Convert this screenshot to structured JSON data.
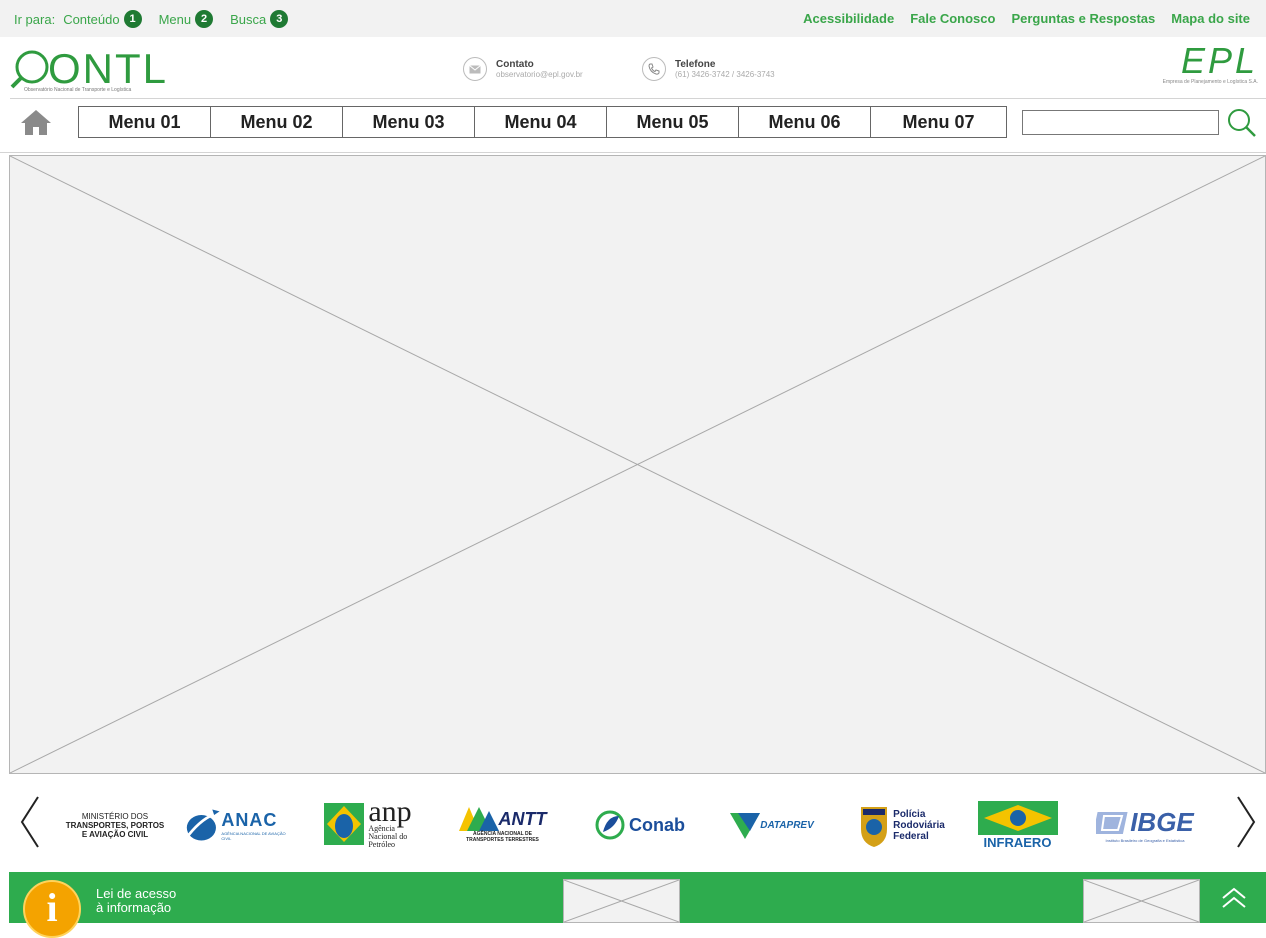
{
  "skip_bar": {
    "label": "Ir para:",
    "items": [
      {
        "label": "Conteúdo",
        "number": "1"
      },
      {
        "label": "Menu",
        "number": "2"
      },
      {
        "label": "Busca",
        "number": "3"
      }
    ]
  },
  "top_links": [
    "Acessibilidade",
    "Fale Conosco",
    "Perguntas e Respostas",
    "Mapa do site"
  ],
  "header": {
    "logo_left": {
      "text": "ONTL",
      "subtitle": "Observatório Nacional de Transporte e Logística"
    },
    "contact": {
      "title": "Contato",
      "value": "observatorio@epl.gov.br",
      "icon": "envelope-icon"
    },
    "phone": {
      "title": "Telefone",
      "value": "(61) 3426-3742 / 3426-3743",
      "icon": "phone-icon"
    },
    "logo_right": {
      "text": "EPL",
      "subtitle": "Empresa de Planejamento e Logística S.A."
    }
  },
  "nav": {
    "home_icon": "home-icon",
    "menu": [
      "Menu 01",
      "Menu 02",
      "Menu 03",
      "Menu 04",
      "Menu 05",
      "Menu 06",
      "Menu 07"
    ],
    "search": {
      "value": "",
      "icon": "search-icon"
    }
  },
  "partners": {
    "prev_icon": "chevron-left-icon",
    "next_icon": "chevron-right-icon",
    "ministerio": {
      "line1": "MINISTÉRIO DOS",
      "line2": "TRANSPORTES, PORTOS",
      "line3": "E AVIAÇÃO CIVIL"
    },
    "anac": {
      "name": "ANAC",
      "sub": "AGÊNCIA NACIONAL DE AVIAÇÃO CIVIL"
    },
    "anp": {
      "name": "anp",
      "sub1": "Agência",
      "sub2": "Nacional do",
      "sub3": "Petróleo"
    },
    "antt": {
      "name": "ANTT",
      "sub1": "AGÊNCIA NACIONAL DE",
      "sub2": "TRANSPORTES TERRESTRES"
    },
    "conab": {
      "name": "Conab"
    },
    "dataprev": {
      "name": "DATAPREV"
    },
    "prf": {
      "line1": "Polícia",
      "line2": "Rodoviária",
      "line3": "Federal"
    },
    "infraero": {
      "name": "INFRAERO"
    },
    "ibge": {
      "name": "IBGE",
      "sub": "Instituto Brasileiro de Geografia e Estatística"
    }
  },
  "footer": {
    "info_letter": "i",
    "lai_line1": "Lei de acesso",
    "lai_line2": "à informação",
    "back_to_top_icon": "double-chevron-up-icon"
  },
  "colors": {
    "accent_green": "#2eac4e",
    "link_green": "#3aa64a",
    "badge_dark_green": "#1f7a33",
    "placeholder_gray": "#f2f2f2"
  }
}
